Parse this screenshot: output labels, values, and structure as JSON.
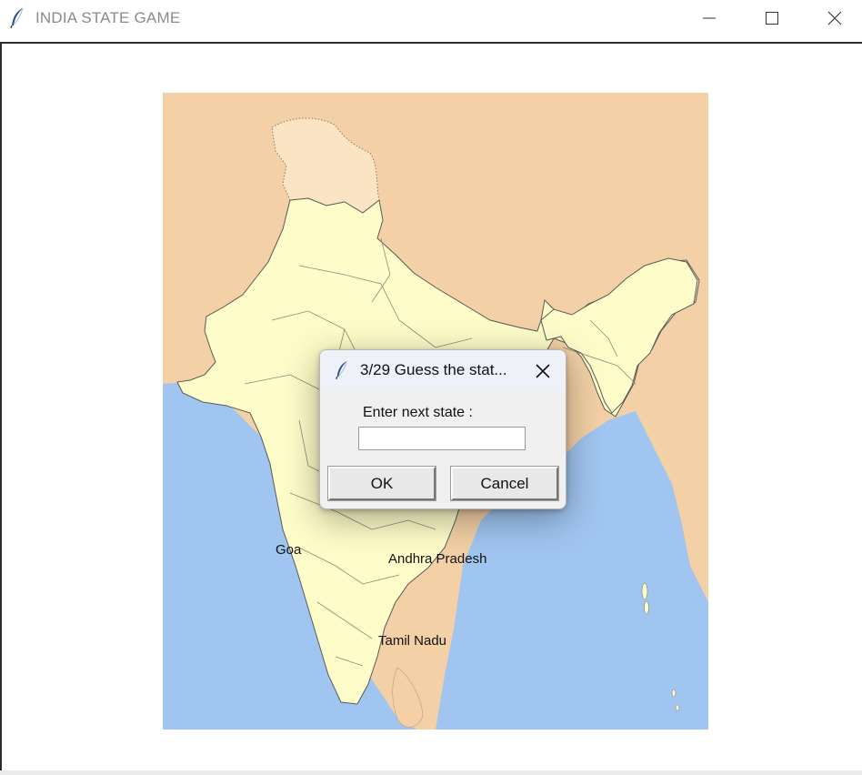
{
  "window": {
    "title": "INDIA STATE GAME",
    "controls": [
      "minimize-icon",
      "maximize-icon",
      "close-icon"
    ]
  },
  "map": {
    "labels": {
      "goa": "Goa",
      "andhra_pradesh": "Andhra Pradesh",
      "tamil_nadu": "Tamil Nadu"
    },
    "colors": {
      "land_neighbours": "#f3d0a5",
      "india": "#fefcc8",
      "sea": "#a0c5f0",
      "border": "#6a6a6a"
    }
  },
  "dialog": {
    "title": "3/29  Guess the stat...",
    "prompt": "Enter next state :",
    "input_value": "",
    "ok_label": "OK",
    "cancel_label": "Cancel"
  }
}
